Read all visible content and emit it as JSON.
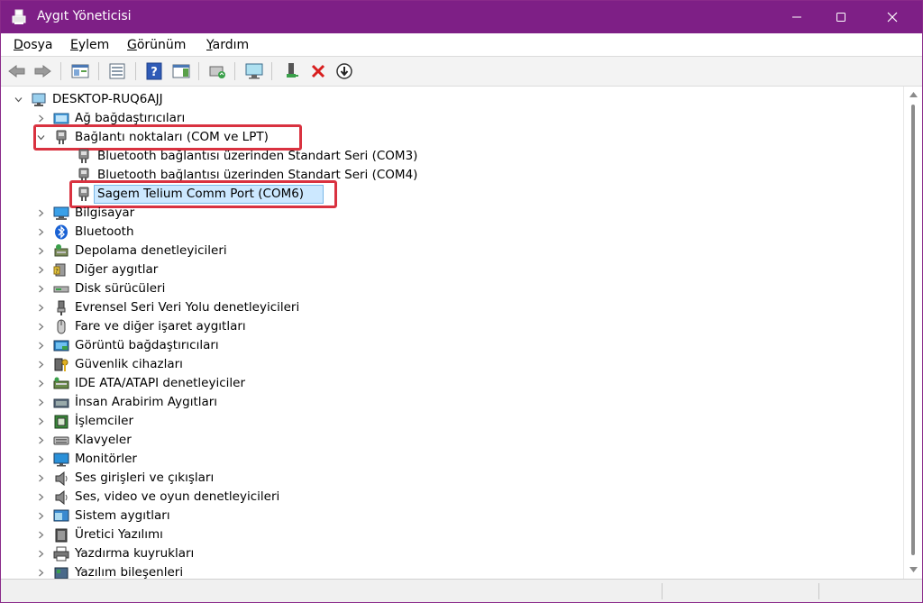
{
  "window": {
    "title": "Aygıt Yöneticisi",
    "accent": "#7e1f86"
  },
  "menu": [
    "Dosya",
    "Eylem",
    "Görünüm",
    "Yardım"
  ],
  "toolbar": [
    "back-icon",
    "forward-icon",
    "show-hide-console-tree-icon",
    "properties-icon",
    "help-icon",
    "action-pane-icon",
    "update-driver-icon",
    "scan-hardware-icon",
    "enable-device-icon",
    "uninstall-device-icon",
    "download-icon"
  ],
  "tree": {
    "root": "DESKTOP-RUQ6AJJ",
    "items": [
      {
        "label": "Ağ bağdaştırıcıları",
        "icon": "network-adapter-icon",
        "expanded": false
      },
      {
        "label": "Bağlantı noktaları (COM ve LPT)",
        "icon": "port-icon",
        "expanded": true,
        "children": [
          {
            "label": "Bluetooth bağlantısı üzerinden Standart Seri (COM3)",
            "icon": "port-icon"
          },
          {
            "label": "Bluetooth bağlantısı üzerinden Standart Seri (COM4)",
            "icon": "port-icon"
          },
          {
            "label": "Sagem Telium Comm Port (COM6)",
            "icon": "port-icon",
            "selected": true
          }
        ]
      },
      {
        "label": "Bilgisayar",
        "icon": "computer-icon",
        "expanded": false
      },
      {
        "label": "Bluetooth",
        "icon": "bluetooth-icon",
        "expanded": false
      },
      {
        "label": "Depolama denetleyicileri",
        "icon": "storage-controller-icon",
        "expanded": false
      },
      {
        "label": "Diğer aygıtlar",
        "icon": "other-devices-icon",
        "expanded": false
      },
      {
        "label": "Disk sürücüleri",
        "icon": "disk-drive-icon",
        "expanded": false
      },
      {
        "label": "Evrensel Seri Veri Yolu denetleyicileri",
        "icon": "usb-icon",
        "expanded": false
      },
      {
        "label": "Fare ve diğer işaret aygıtları",
        "icon": "mouse-icon",
        "expanded": false
      },
      {
        "label": "Görüntü bağdaştırıcıları",
        "icon": "display-adapter-icon",
        "expanded": false
      },
      {
        "label": "Güvenlik cihazları",
        "icon": "security-device-icon",
        "expanded": false
      },
      {
        "label": "IDE ATA/ATAPI denetleyiciler",
        "icon": "ide-controller-icon",
        "expanded": false
      },
      {
        "label": "İnsan Arabirim Aygıtları",
        "icon": "hid-icon",
        "expanded": false
      },
      {
        "label": "İşlemciler",
        "icon": "processor-icon",
        "expanded": false
      },
      {
        "label": "Klavyeler",
        "icon": "keyboard-icon",
        "expanded": false
      },
      {
        "label": "Monitörler",
        "icon": "monitor-icon",
        "expanded": false
      },
      {
        "label": "Ses girişleri ve çıkışları",
        "icon": "speaker-icon",
        "expanded": false
      },
      {
        "label": "Ses, video ve oyun denetleyicileri",
        "icon": "speaker-icon",
        "expanded": false
      },
      {
        "label": "Sistem aygıtları",
        "icon": "system-device-icon",
        "expanded": false
      },
      {
        "label": "Üretici Yazılımı",
        "icon": "firmware-icon",
        "expanded": false
      },
      {
        "label": "Yazdırma kuyrukları",
        "icon": "printer-icon",
        "expanded": false
      },
      {
        "label": "Yazılım bileşenleri",
        "icon": "software-component-icon",
        "expanded": false
      }
    ]
  },
  "highlight_color": "#d93240"
}
